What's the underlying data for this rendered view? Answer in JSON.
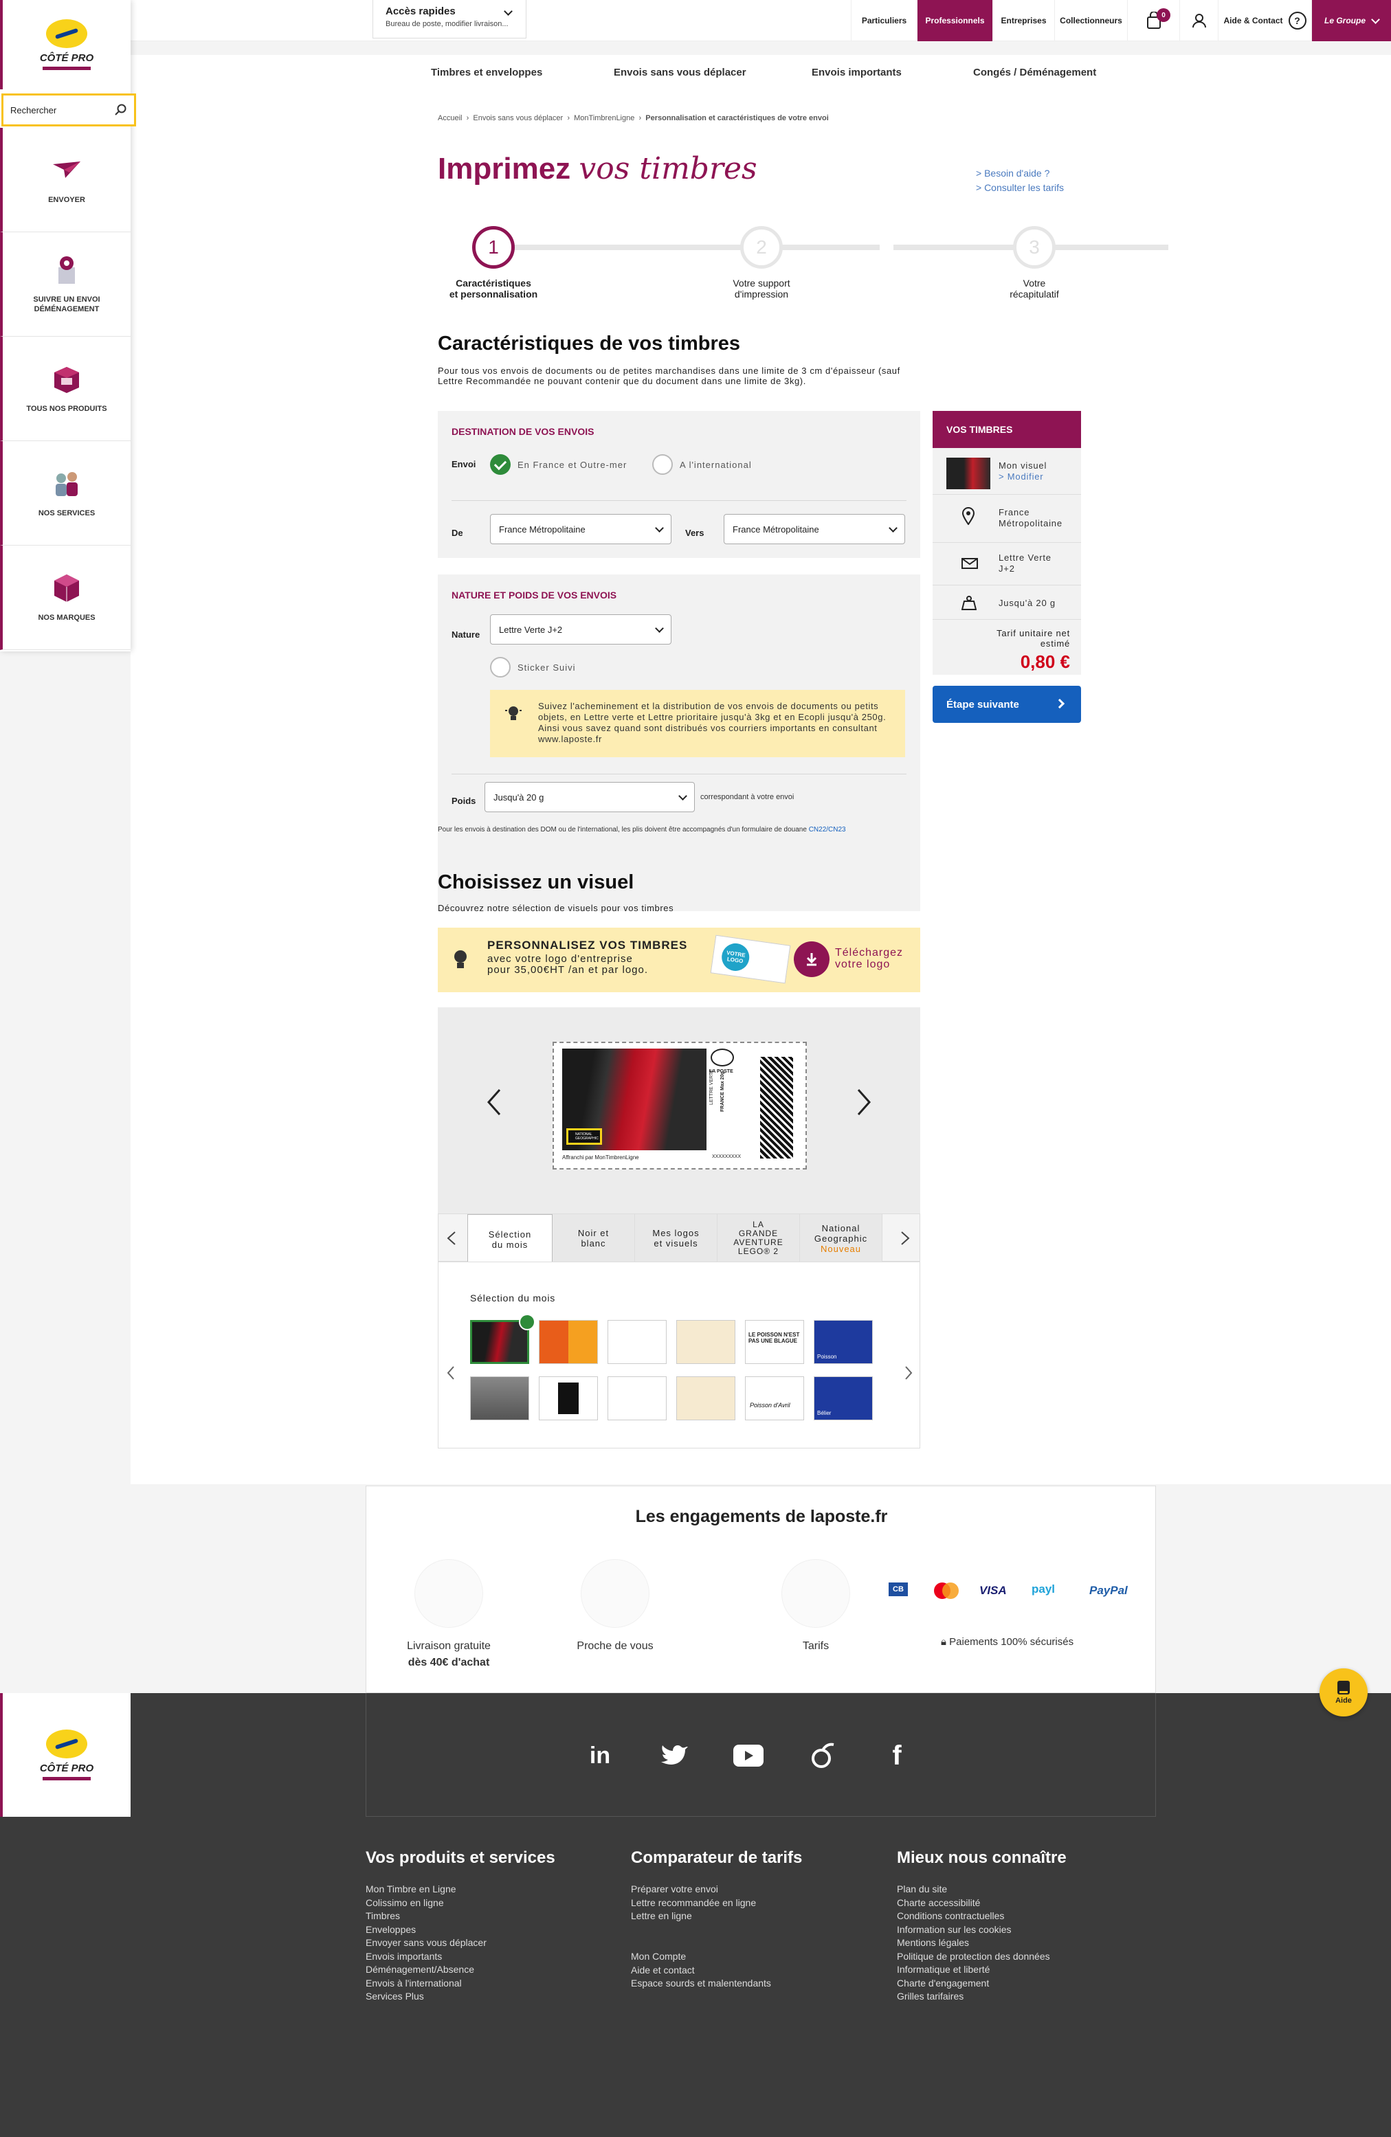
{
  "header": {
    "quick_title": "Accès rapides",
    "quick_sub": "Bureau de poste, modifier livraison...",
    "nav": [
      "Particuliers",
      "Professionnels",
      "Entreprises",
      "Collectionneurs"
    ],
    "cart_count": "0",
    "aide_contact": "Aide & Contact",
    "groupe": "Le Groupe"
  },
  "secondary_nav": [
    "Timbres et enveloppes",
    "Envois sans vous déplacer",
    "Envois importants",
    "Congés / Déménagement"
  ],
  "sidebar": {
    "logo_text": "CÔTÉ PRO",
    "search_placeholder": "Rechercher",
    "items": [
      {
        "label": "ENVOYER",
        "icon": "send-plane-icon"
      },
      {
        "label": "SUIVRE UN ENVOI\nDÉMÉNAGEMENT",
        "icon": "tracking-icon"
      },
      {
        "label": "TOUS NOS PRODUITS",
        "icon": "products-box-icon"
      },
      {
        "label": "NOS SERVICES",
        "icon": "services-people-icon"
      },
      {
        "label": "NOS MARQUES",
        "icon": "brands-cube-icon"
      }
    ]
  },
  "breadcrumb": [
    "Accueil",
    "Envois sans vous déplacer",
    "MonTimbrenLigne",
    "Personnalisation et caractéristiques de votre envoi"
  ],
  "page": {
    "title_bold": "Imprimez",
    "title_italic": "vos timbres",
    "help1": "> Besoin d'aide ?",
    "help2": "> Consulter les tarifs"
  },
  "steps": [
    {
      "num": "1",
      "label": "Caractéristiques\net personnalisation"
    },
    {
      "num": "2",
      "label": "Votre support\nd'impression"
    },
    {
      "num": "3",
      "label": "Votre\nrécapitulatif"
    }
  ],
  "characteristics": {
    "heading": "Caractéristiques de vos timbres",
    "intro": "Pour tous vos envois de documents ou de petites marchandises dans une limite de 3 cm d'épaisseur (sauf Lettre Recommandée ne pouvant contenir que du document dans une limite de 3kg).",
    "destination_title": "DESTINATION DE VOS ENVOIS",
    "envoi_label": "Envoi",
    "opt_france": "En France et Outre-mer",
    "opt_intl": "A l'international",
    "de_label": "De",
    "de_value": "France Métropolitaine",
    "vers_label": "Vers",
    "vers_value": "France Métropolitaine",
    "nature_title": "NATURE ET POIDS DE VOS ENVOIS",
    "nature_label": "Nature",
    "nature_value": "Lettre Verte J+2",
    "sticker": "Sticker Suivi",
    "tip": "Suivez l'acheminement et la distribution de vos envois de documents ou petits objets, en Lettre verte et Lettre prioritaire jusqu'à 3kg et en Ecopli jusqu'à 250g. Ainsi vous savez quand sont distribués vos courriers importants en consultant www.laposte.fr",
    "poids_label": "Poids",
    "poids_value": "Jusqu'à 20 g",
    "poids_note": "correspondant à votre envoi",
    "customs_note": "Pour les envois à destination des DOM ou de l'international, les plis doivent être accompagnés d'un formulaire de douane",
    "customs_link": "CN22/CN23"
  },
  "summary": {
    "title": "VOS TIMBRES",
    "visual_label": "Mon visuel",
    "modify": "> Modifier",
    "destination": "France\nMétropolitaine",
    "product": "Lettre Verte\nJ+2",
    "weight": "Jusqu'à 20 g",
    "price_label": "Tarif unitaire net\nestimé",
    "price": "0,80 €",
    "next_button": "Étape suivante"
  },
  "visual": {
    "heading": "Choisissez un visuel",
    "sub": "Découvrez notre sélection de visuels pour vos timbres",
    "promo_title": "PERSONNALISEZ VOS TIMBRES",
    "promo_text": "avec votre logo d'entreprise\npour 35,00€HT /an et par logo.",
    "promo_logo": "VOTRE LOGO",
    "promo_cta": "Téléchargez\nvotre logo",
    "stamp_brand": "LA POSTE",
    "stamp_type": "LETTRE VERTE",
    "stamp_dest": "FRANCE Max 20g",
    "stamp_ng": "NATIONAL GEOGRAPHIC",
    "stamp_footer": "Affranchi par MonTimbrenLigne",
    "stamp_code": "XXXXXXXXX",
    "tabs": [
      "Sélection\ndu mois",
      "Noir et\nblanc",
      "Mes logos\net visuels",
      "LA\nGRANDE\nAVENTURE\nLEGO® 2",
      "National\nGeographic"
    ],
    "tab_badge": "Nouveau",
    "gallery_title": "Sélection du mois",
    "thumb_texts": [
      "Poisson",
      "LE POISSON N'EST PAS UNE BLAGUE",
      "Poisson d'Avril",
      "Bélier"
    ]
  },
  "engagements": {
    "title": "Les engagements de laposte.fr",
    "items": [
      {
        "label": "Livraison gratuite",
        "sub": "dès 40€ d'achat"
      },
      {
        "label": "Proche de vous",
        "sub": ""
      },
      {
        "label": "Tarifs",
        "sub": ""
      }
    ],
    "payments": [
      "CB",
      "mastercard",
      "VISA",
      "payl",
      "PayPal"
    ],
    "secure": "Paiements 100% sécurisés"
  },
  "aide_button": "Aide",
  "footer": {
    "col1_title": "Vos produits et services",
    "col1": [
      "Mon Timbre en Ligne",
      "Colissimo en ligne",
      "Timbres",
      "Enveloppes",
      "Envoyer sans vous déplacer",
      "Envois importants",
      "Déménagement/Absence",
      "Envois à l'international",
      "Services Plus"
    ],
    "col2_title": "Comparateur de tarifs",
    "col2": [
      "Préparer votre envoi",
      "Lettre recommandée en ligne",
      "Lettre en ligne"
    ],
    "col2b": [
      "Mon Compte",
      "Aide et contact",
      "Espace sourds et malentendants"
    ],
    "col3_title": "Mieux nous connaître",
    "col3": [
      "Plan du site",
      "Charte accessibilité",
      "Conditions contractuelles",
      "Information sur les cookies",
      "Mentions légales",
      "Politique de protection des données",
      "Informatique et liberté",
      "Charte d'engagement",
      "Grilles tarifaires"
    ]
  },
  "colors": {
    "brand": "#8e1453",
    "accent_yellow": "#f8c21a",
    "button_blue": "#1560bd",
    "price_red": "#d0021b",
    "success_green": "#2e8b3a"
  }
}
